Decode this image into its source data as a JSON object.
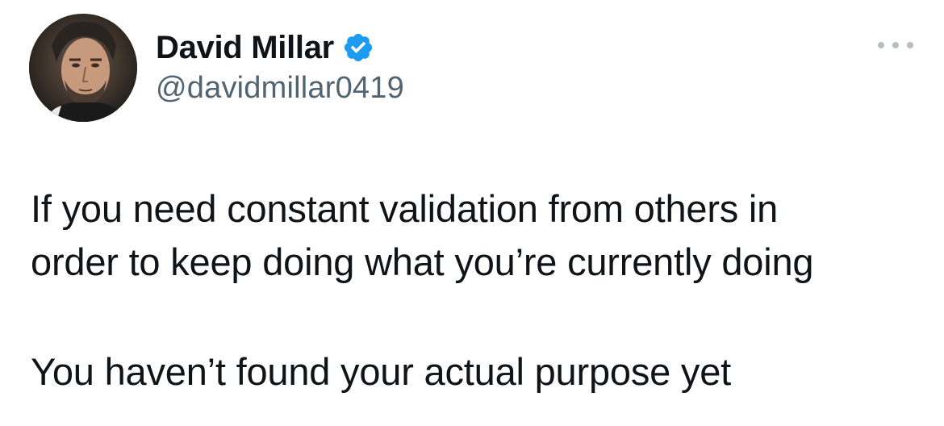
{
  "author": {
    "display_name": "David Millar",
    "handle": "@davidmillar0419",
    "verified_icon": "verified-badge-icon",
    "verified_color": "#1d9bf0",
    "avatar_icon": "profile-avatar"
  },
  "menu": {
    "icon": "more-options-icon"
  },
  "tweet": {
    "lines": [
      "If you need constant validation from others in",
      "order to keep doing what you’re currently doing"
    ],
    "second_paragraph": "You haven’t found your actual purpose yet"
  },
  "colors": {
    "text": "#0f1419",
    "handle": "#536471",
    "background": "#ffffff"
  }
}
